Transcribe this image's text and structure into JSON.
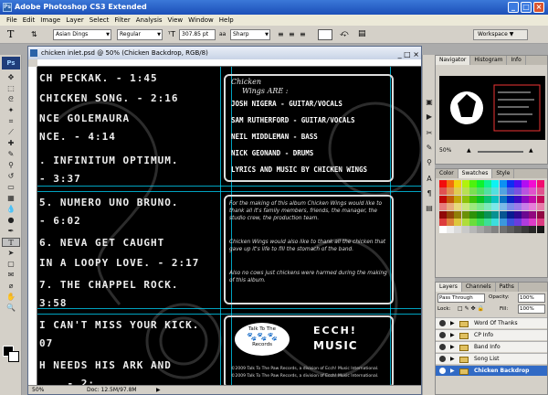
{
  "app": {
    "title": "Adobe Photoshop CS3 Extended",
    "logo": "Ps",
    "window_controls": [
      "minimize-icon",
      "maximize-icon",
      "close-icon"
    ]
  },
  "menu": [
    "File",
    "Edit",
    "Image",
    "Layer",
    "Select",
    "Filter",
    "Analysis",
    "View",
    "Window",
    "Help"
  ],
  "options": {
    "tool_glyph": "T",
    "font_family": "Asian Dings",
    "font_style": "Regular",
    "font_size": "307.85 pt",
    "antialias_prefix": "aa",
    "antialias": "Sharp",
    "workspace": "Workspace"
  },
  "document": {
    "title": "chicken inlet.psd @ 50% (Chicken Backdrop, RGB/8)",
    "zoom": "50%",
    "doc_info": "Doc: 12.5M/97.8M",
    "songs": [
      "CH PECKAK. - 1:45",
      "CHICKEN SONG. - 2:16",
      "NCE GOLEMAURA",
      "NCE. - 4:14",
      ". INFINITUM OPTIMUM.",
      "- 3:37",
      "5. NUMERO UNO BRUNO.",
      "  - 6:02",
      "6. NEVA GET CAUGHT",
      "IN A LOOPY LOVE. - 2:17",
      "7. THE CHAPPEL ROCK.",
      "3:58",
      "I CAN'T MISS YOUR KICK.",
      "07",
      "H NEEDS HIS ARK AND",
      "... - 2:..."
    ],
    "credits_heading_1": "Chicken",
    "credits_heading_2": "Wings   ARE :",
    "credits": [
      "JOSH NIGERA - GUITAR/VOCALS",
      "SAM RUTHERFORD - GUITAR/VOCALS",
      "NEIL MIDDLEMAN - BASS",
      "NICK GEONAND - DRUMS",
      "LYRICS AND MUSIC BY CHICKEN WINGS"
    ],
    "thanks": [
      "For the making of this album Chicken Wings would like to thank all it's family members, friends, the manager, the studio crew, the production team.",
      "Chicken Wings would also like to thank all the chicken that gave up it's life to fill the stomach of the band.",
      "Also no cows just chickens were harmed during the making of this album."
    ],
    "label_bubble_1": "Talk To The",
    "label_bubble_2": "Records",
    "label_brand_1": "ECCH!",
    "label_brand_2": "MUSIC",
    "label_copyright_1": "©2009 Talk To The Paw Records, a division of Ecch! Music International.",
    "label_copyright_2": "©2009 Talk To The Paw Records, a division of Ecch! Music International."
  },
  "panels": {
    "navigator_tabs": [
      "Navigator",
      "Histogram",
      "Info"
    ],
    "color_tabs": [
      "Color",
      "Swatches",
      "Style"
    ],
    "layers_tabs": [
      "Layers",
      "Channels",
      "Paths"
    ],
    "blend_mode": "Pass Through",
    "opacity_label": "Opacity:",
    "opacity": "100%",
    "fill_label": "Fill:",
    "fill": "100%",
    "lock_label": "Lock:",
    "layers": [
      "Word Of Thanks",
      "CP Info",
      "Band Info",
      "Song List",
      "Chicken Backdrop"
    ],
    "selected_layer": "Chicken Backdrop"
  },
  "colors": {
    "titlebar": "#1c4fb8",
    "canvas_bg": "#000000",
    "guide": "#00d8ff",
    "selection": "#316ac5"
  }
}
